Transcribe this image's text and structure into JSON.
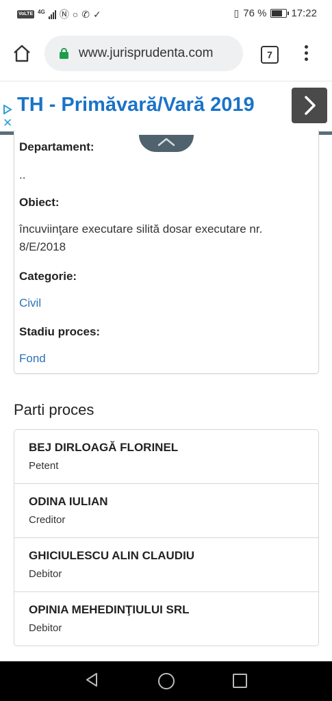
{
  "status_bar": {
    "volte": "VoLTE",
    "network": "4G",
    "battery_percent": "76 %",
    "battery_level": 0.76,
    "time": "17:22"
  },
  "browser": {
    "url": "www.jurisprudenta.com",
    "tab_count": "7"
  },
  "ad": {
    "title": "TH - Primăvară/Vară 2019",
    "close_glyph": "✕"
  },
  "details": {
    "department_label": "Departament:",
    "department_value": "..",
    "object_label": "Obiect:",
    "object_value": "încuviinţare executare silită dosar executare nr. 8/E/2018",
    "category_label": "Categorie:",
    "category_value": "Civil",
    "stage_label": "Stadiu proces:",
    "stage_value": "Fond"
  },
  "parties": {
    "title": "Parti proces",
    "items": [
      {
        "name": "BEJ DIRLOAGĂ FLORINEL",
        "role": "Petent"
      },
      {
        "name": "ODINA IULIAN",
        "role": "Creditor"
      },
      {
        "name": "GHICIULESCU ALIN CLAUDIU",
        "role": "Debitor"
      },
      {
        "name": "OPINIA MEHEDINŢIULUI SRL",
        "role": "Debitor"
      }
    ]
  },
  "colors": {
    "link": "#2c72b8",
    "ad_title": "#1a73c8",
    "lock": "#1e9e4a"
  }
}
